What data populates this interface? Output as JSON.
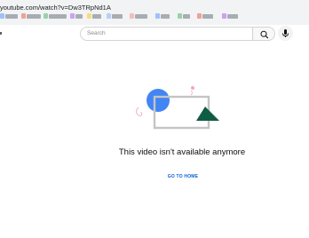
{
  "browser": {
    "url": "youtube.com/watch?v=Dw3TRpNd1A"
  },
  "header": {
    "search_placeholder": "Search"
  },
  "error": {
    "message": "This video isn't available anymore",
    "home_button_label": "GO TO HOME"
  },
  "colors": {
    "link_blue": "#065fd4",
    "blue_circle": "#4285f4",
    "green_triangle": "#0f5c45",
    "pink_accent": "#f6a9b5",
    "frame_gray": "#c4c4c4"
  },
  "icons": {
    "search": "search-icon",
    "mic": "microphone-icon"
  }
}
